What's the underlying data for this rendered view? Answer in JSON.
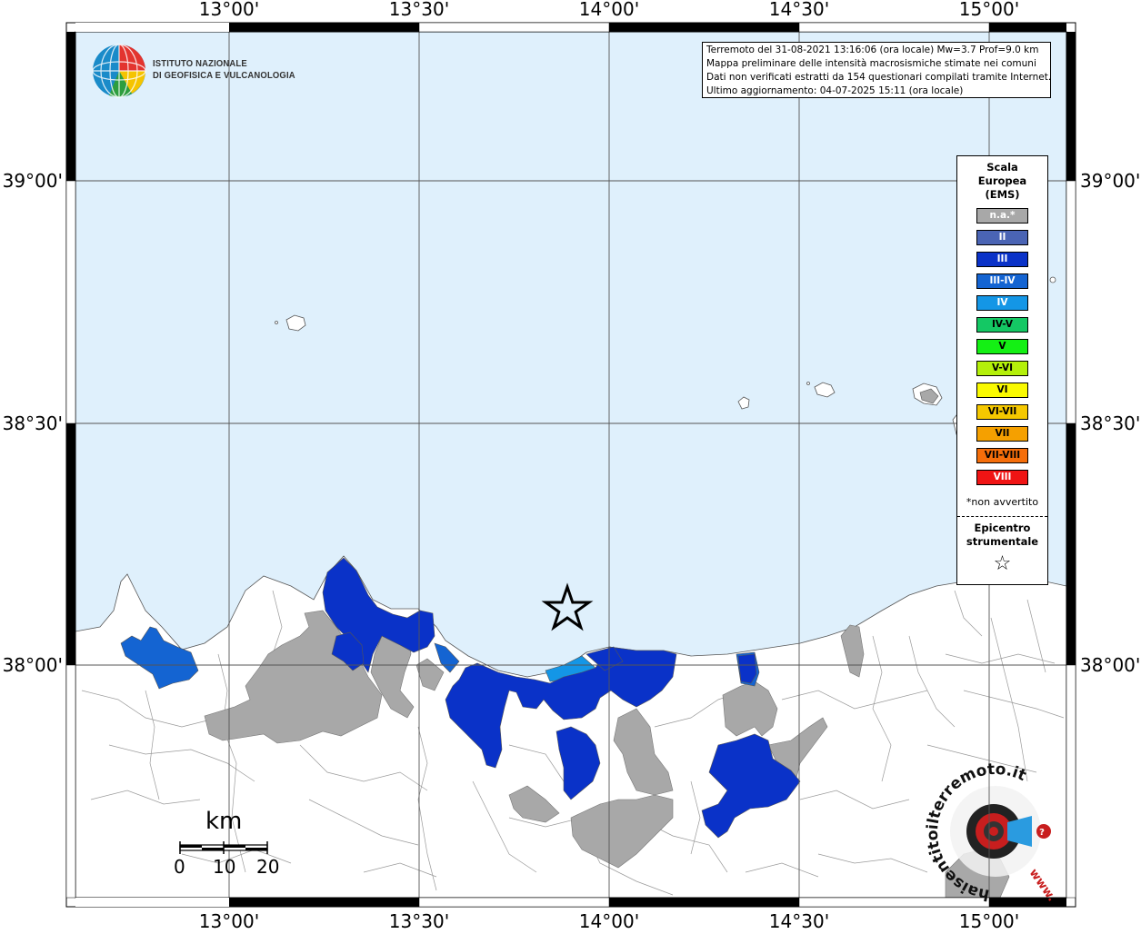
{
  "info": {
    "lines": [
      "Terremoto del 31-08-2021 13:16:06 (ora locale) Mw=3.7 Prof=9.0 km",
      "Mappa preliminare delle intensità macrosismiche stimate nei comuni",
      "Dati non verificati estratti da 154 questionari compilati tramite Internet.",
      "Ultimo aggiornamento: 04-07-2025 15:11 (ora locale)"
    ]
  },
  "logo": {
    "line1": "ISTITUTO NAZIONALE",
    "line2": "DI GEOFISICA E VULCANOLOGIA"
  },
  "axes": {
    "lon_top": [
      "13°00'",
      "13°30'",
      "14°00'",
      "14°30'",
      "15°00'"
    ],
    "lon_bottom": [
      "13°00'",
      "13°30'",
      "14°00'",
      "14°30'",
      "15°00'"
    ],
    "lat_left": [
      "39°00'",
      "38°30'",
      "38°00'"
    ],
    "lat_right": [
      "39°00'",
      "38°30'",
      "38°00'"
    ]
  },
  "legend": {
    "title": [
      "Scala",
      "Europea",
      "(EMS)"
    ],
    "items": [
      {
        "label": "n.a.*",
        "color": "#a8a8a8",
        "text_color": "#ffffff"
      },
      {
        "label": "II",
        "color": "#4a64b4",
        "text_color": "#ffffff"
      },
      {
        "label": "III",
        "color": "#0a32c8",
        "text_color": "#ffffff"
      },
      {
        "label": "III-IV",
        "color": "#1464d2",
        "text_color": "#ffffff"
      },
      {
        "label": "IV",
        "color": "#1496e6",
        "text_color": "#ffffff"
      },
      {
        "label": "IV-V",
        "color": "#14c864",
        "text_color": "#000000"
      },
      {
        "label": "V",
        "color": "#14f014",
        "text_color": "#000000"
      },
      {
        "label": "V-VI",
        "color": "#b4f00a",
        "text_color": "#000000"
      },
      {
        "label": "VI",
        "color": "#fafa00",
        "text_color": "#000000"
      },
      {
        "label": "VI-VII",
        "color": "#f5c800",
        "text_color": "#000000"
      },
      {
        "label": "VII",
        "color": "#f5a000",
        "text_color": "#000000"
      },
      {
        "label": "VII-VIII",
        "color": "#f56e0a",
        "text_color": "#000000"
      },
      {
        "label": "VIII",
        "color": "#f01414",
        "text_color": "#ffffff"
      }
    ],
    "note": "*non avvertito",
    "epicenter_label": [
      "Epicentro",
      "strumentale"
    ],
    "epicenter_symbol": "☆"
  },
  "scalebar": {
    "unit": "km",
    "ticks": [
      "0",
      "10",
      "20"
    ]
  },
  "watermark": {
    "text": "haisentitoilterremoto.it",
    "url": "www."
  },
  "colors": {
    "sea": "#dff0fc",
    "land": "#ffffff",
    "not_felt": "#a8a8a8",
    "III": "#0a32c8",
    "III_IV": "#1464d2",
    "IV": "#1496e6"
  }
}
